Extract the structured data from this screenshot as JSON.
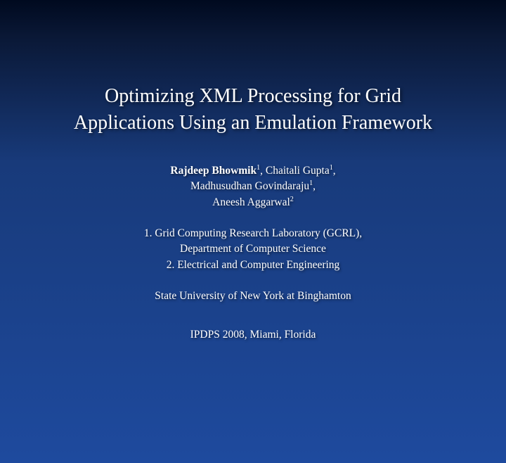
{
  "title_line1": "Optimizing XML Processing for Grid",
  "title_line2": "Applications Using an Emulation Framework",
  "author1_name": "Rajdeep Bhowmik",
  "author1_sup": "1",
  "author2_name": ", Chaitali Gupta",
  "author2_sup": "1",
  "author2_tail": ",",
  "author3_name": "Madhusudhan Govindaraju",
  "author3_sup": "1",
  "author3_tail": ",",
  "author4_name": "Aneesh Aggarwal",
  "author4_sup": "2",
  "affil1": "1. Grid Computing Research Laboratory (GCRL),",
  "affil1b": "Department of Computer Science",
  "affil2": "2. Electrical and Computer Engineering",
  "university": "State University of New York at Binghamton",
  "venue": "IPDPS 2008, Miami, Florida"
}
